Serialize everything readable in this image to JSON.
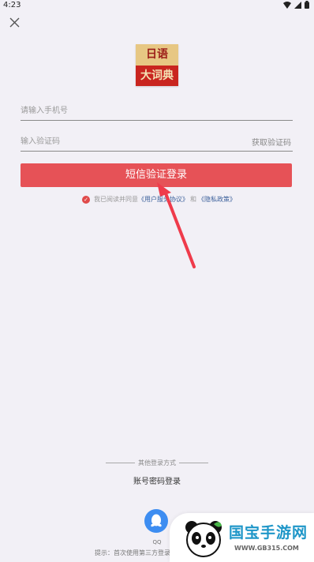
{
  "status_bar": {
    "time": "4:23"
  },
  "logo": {
    "line1": "日语",
    "line2": "大词典"
  },
  "phone_input": {
    "placeholder": "请输入手机号",
    "value": ""
  },
  "code_input": {
    "placeholder": "输入验证码",
    "value": ""
  },
  "get_code_label": "获取验证码",
  "login_button_label": "短信验证登录",
  "agreement": {
    "checked": true,
    "prefix": "我已阅读并同意",
    "user_agreement_link": "《用户服务协议》",
    "conjunction": "和",
    "privacy_link": "《隐私政策》"
  },
  "other_login": {
    "title": "其他登录方式",
    "account_login_label": "账号密码登录",
    "qq_label": "QQ",
    "tip": "提示：首次使用第三方登录，"
  },
  "watermark": {
    "text": "国宝手游网",
    "url": "WWW.GB315.COM"
  },
  "colors": {
    "accent": "#e65257",
    "link": "#3a5f9a",
    "qq": "#3d8df1",
    "background": "#f2f0f6"
  }
}
